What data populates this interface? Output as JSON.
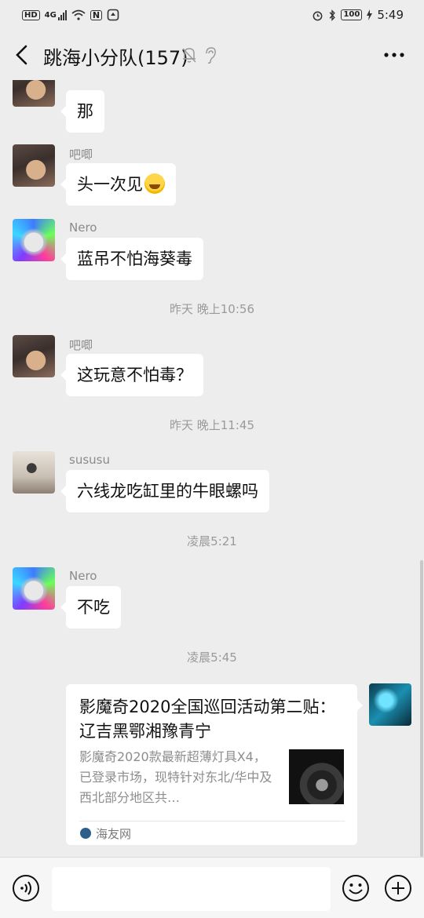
{
  "status_bar": {
    "network_badge": "HD",
    "network_type": "4G",
    "nfc_label": "N",
    "battery_level": "100",
    "time": "5:49",
    "icons": [
      "signal-icon",
      "wifi-icon",
      "nfc-icon",
      "alarm-icon",
      "bluetooth-icon",
      "battery-icon",
      "charging-icon"
    ]
  },
  "header": {
    "title": "跳海小分队(157)",
    "icons": [
      "back-icon",
      "mute-icon",
      "ear-icon",
      "more-icon"
    ]
  },
  "messages": [
    {
      "sender": "吧唧",
      "text": "那",
      "avatar": "dog-photo"
    },
    {
      "sender": "吧唧",
      "text": "头一次见",
      "emoji": "laughing-crying-emoji",
      "avatar": "dog-photo"
    },
    {
      "sender": "Nero",
      "text": "蓝吊不怕海葵毒",
      "avatar": "cat-neon"
    },
    {
      "timestamp": "昨天 晚上10:56"
    },
    {
      "sender": "吧唧",
      "text": "这玩意不怕毒？",
      "avatar": "dog-photo"
    },
    {
      "timestamp": "昨天 晚上11:45"
    },
    {
      "sender": "sususu",
      "text": "六线龙吃缸里的牛眼螺吗",
      "avatar": "child-photo"
    },
    {
      "timestamp": "凌晨5:21"
    },
    {
      "sender": "Nero",
      "text": "不吃",
      "avatar": "cat-neon"
    },
    {
      "timestamp": "凌晨5:45"
    }
  ],
  "link_card": {
    "title": "影魔奇2020全国巡回活动第二贴： 辽吉黑鄂湘豫青宁",
    "description": "影魔奇2020款最新超薄灯具X4，已登录市场，现特针对东北/华中及西北部分地区共…",
    "source": "海友网",
    "avatar": "underwater-photo"
  },
  "input_bar": {
    "placeholder": "",
    "icons": [
      "voice-icon",
      "emoji-icon",
      "plus-icon"
    ]
  }
}
